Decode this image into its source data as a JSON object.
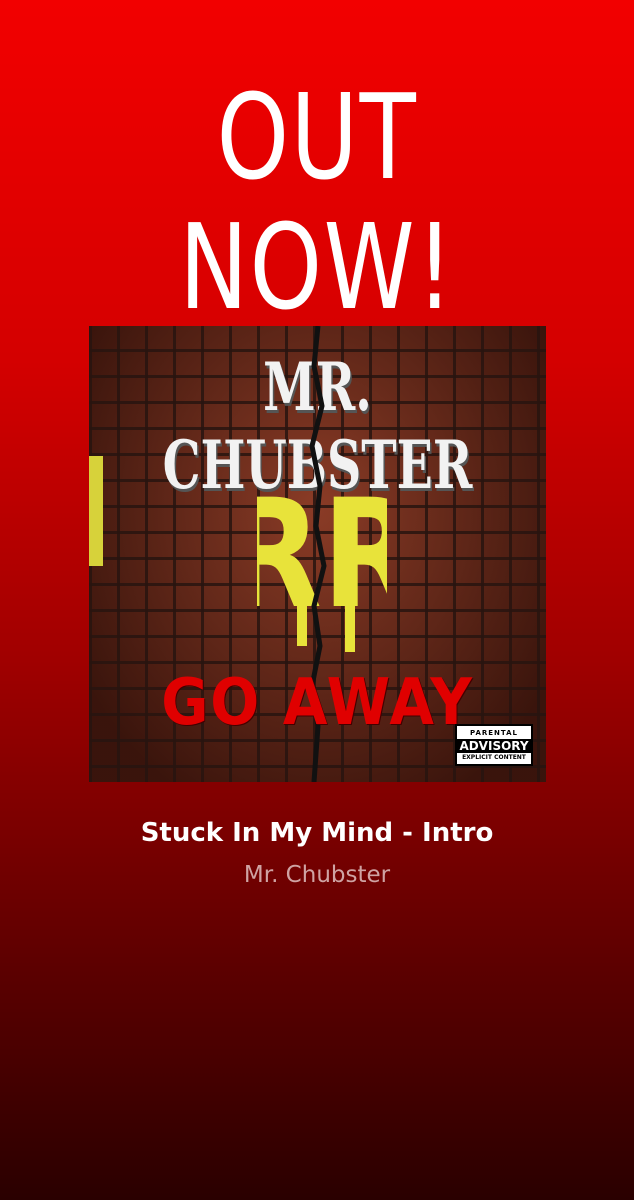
{
  "story": {
    "headline": "OUT NOW!"
  },
  "cover_art": {
    "artist_text": "MR. CHUBSTER",
    "logo_text": "RR",
    "title_text": "GO AWAY",
    "advisory": {
      "line1": "PARENTAL",
      "line2": "ADVISORY",
      "line3": "EXPLICIT CONTENT"
    }
  },
  "track": {
    "title": "Stuck In My Mind - Intro",
    "artist": "Mr. Chubster"
  },
  "colors": {
    "background_top": "#f20000",
    "background_bottom": "#2a0000",
    "logo_yellow": "#e8e33a",
    "title_red": "#e00000"
  }
}
